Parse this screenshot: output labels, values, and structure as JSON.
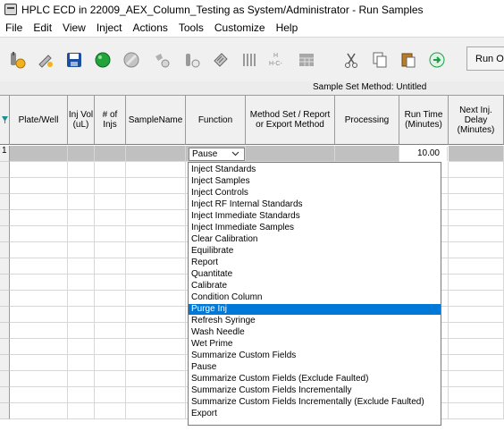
{
  "window": {
    "title": "HPLC ECD in 22009_AEX_Column_Testing as System/Administrator - Run Samples"
  },
  "menu": [
    "File",
    "Edit",
    "View",
    "Inject",
    "Actions",
    "Tools",
    "Customize",
    "Help"
  ],
  "toolbar": {
    "icons": [
      "open-sample-set-icon",
      "inject-icon",
      "save-icon",
      "green-status-icon",
      "gray-status-icon",
      "stop-icon",
      "reload-icon",
      "tag-icon",
      "columns-icon",
      "method-icon",
      "table-icon",
      "cut-icon",
      "copy-icon",
      "paste-icon",
      "navigate-icon"
    ],
    "run_label": "Run On"
  },
  "sample_set": {
    "method_label": "Sample Set Method: Untitled"
  },
  "table": {
    "columns": [
      {
        "key": "plate_well",
        "label": "Plate/Well"
      },
      {
        "key": "inj_vol",
        "label": "Inj Vol (uL)"
      },
      {
        "key": "num_injs",
        "label": "# of Injs"
      },
      {
        "key": "sample_name",
        "label": "SampleName"
      },
      {
        "key": "function",
        "label": "Function"
      },
      {
        "key": "method_set",
        "label": "Method Set / Report or Export Method"
      },
      {
        "key": "processing",
        "label": "Processing"
      },
      {
        "key": "run_time",
        "label": "Run Time (Minutes)"
      },
      {
        "key": "next_inj_delay",
        "label": "Next Inj. Delay (Minutes)"
      }
    ],
    "rows": [
      {
        "num": "1",
        "function": "Pause",
        "run_time": "10.00"
      }
    ]
  },
  "function_dropdown": {
    "selected_index": 12,
    "options": [
      "Inject Standards",
      "Inject Samples",
      "Inject Controls",
      "Inject RF Internal Standards",
      "Inject Immediate Standards",
      "Inject Immediate Samples",
      "Clear Calibration",
      "Equilibrate",
      "Report",
      "Quantitate",
      "Calibrate",
      "Condition Column",
      "Purge Inj",
      "Refresh Syringe",
      "Wash Needle",
      "Wet Prime",
      "Summarize Custom Fields",
      "Pause",
      "Summarize Custom Fields (Exclude Faulted)",
      "Summarize Custom Fields Incrementally",
      "Summarize Custom Fields Incrementally (Exclude Faulted)",
      "Export"
    ]
  },
  "colors": {
    "selection": "#0078d7",
    "row_highlight": "#c0c0c0",
    "header_bg": "#f0f0f0"
  }
}
